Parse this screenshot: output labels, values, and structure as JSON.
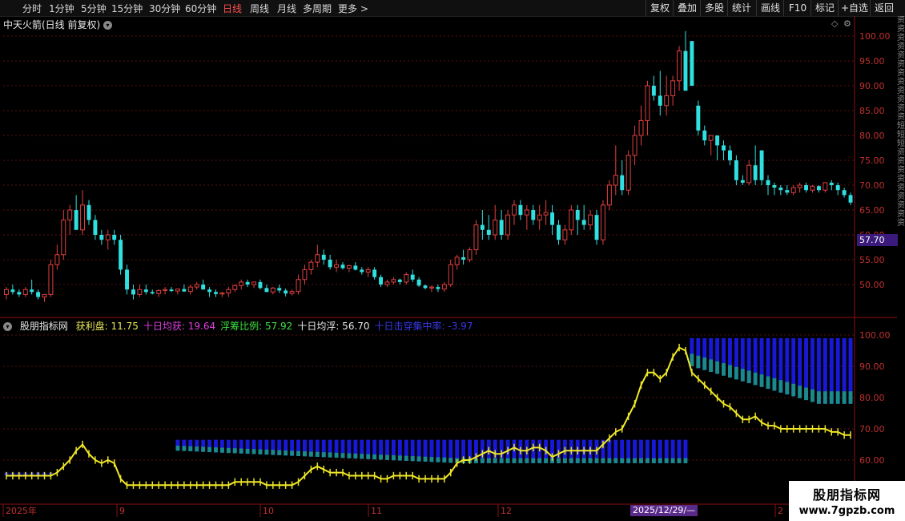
{
  "toolbar": {
    "periods": [
      "分时",
      "1分钟",
      "5分钟",
      "15分钟",
      "30分钟",
      "60分钟",
      "日线",
      "周线",
      "月线",
      "多周期",
      "更多 >"
    ],
    "active_period": "日线",
    "right_buttons": [
      "复权",
      "叠加",
      "多股",
      "统计",
      "画线",
      "F10",
      "标记",
      "+自选",
      "返回"
    ]
  },
  "main_chart": {
    "title": "中天火箭(日线 前复权)",
    "current_price_label": "57.70"
  },
  "indicator": {
    "name": "股朋指标网",
    "items": [
      {
        "label": "获利盘: 11.75",
        "color": "#e8e85a"
      },
      {
        "label": "十日均获: 19.64",
        "color": "#e040e0"
      },
      {
        "label": "浮筹比例: 57.92",
        "color": "#40e040"
      },
      {
        "label": "十日均浮: 56.70",
        "color": "#e8e8e8"
      },
      {
        "label": "十日击穿集中率: -3.97",
        "color": "#3838e8"
      }
    ]
  },
  "x_axis": {
    "labels": [
      "2025年",
      "9",
      "10",
      "11",
      "12",
      "2"
    ],
    "date_badge": "2025/12/29/—"
  },
  "watermark": {
    "title": "股朋指标网",
    "url": "www.7gpzb.com"
  },
  "side_strip": "资资资资资资资资资资资资短短短资资资资资资资资资",
  "chart_data": [
    {
      "type": "candlestick",
      "title": "中天火箭(日线 前复权)",
      "ylim": [
        44,
        101
      ],
      "y_ticks": [
        50,
        55,
        60,
        65,
        70,
        75,
        80,
        85,
        90,
        95,
        100
      ],
      "ohlc": [
        [
          48,
          49.5,
          47,
          49
        ],
        [
          49,
          50,
          48,
          48.5
        ],
        [
          48.5,
          49,
          47.5,
          48
        ],
        [
          48,
          49.5,
          47.5,
          49
        ],
        [
          49,
          51,
          48,
          48.5
        ],
        [
          48.5,
          49,
          47,
          47.5
        ],
        [
          47.5,
          48,
          46.5,
          48
        ],
        [
          48,
          55,
          47.5,
          54
        ],
        [
          54,
          58,
          53,
          56
        ],
        [
          56,
          65,
          55,
          63
        ],
        [
          63,
          66,
          60,
          65
        ],
        [
          65,
          68,
          63,
          61
        ],
        [
          61,
          69,
          60,
          66
        ],
        [
          66,
          67,
          62,
          63
        ],
        [
          63,
          64,
          59,
          60
        ],
        [
          60,
          61,
          58,
          59
        ],
        [
          59,
          61,
          57,
          60
        ],
        [
          60,
          61,
          58,
          59
        ],
        [
          59,
          60,
          52,
          53
        ],
        [
          53,
          54,
          48,
          49
        ],
        [
          49,
          50,
          47,
          48
        ],
        [
          48,
          50,
          47.5,
          49
        ],
        [
          49,
          50,
          48,
          48.5
        ],
        [
          48.5,
          49,
          48,
          48.2
        ],
        [
          48.2,
          49,
          47.5,
          48.8
        ],
        [
          48.8,
          49.5,
          48,
          49
        ],
        [
          49,
          49.5,
          48.5,
          48.7
        ],
        [
          48.7,
          49.2,
          48,
          49.1
        ],
        [
          49.1,
          50,
          48.5,
          48.6
        ],
        [
          48.6,
          50,
          48,
          49.5
        ],
        [
          49.5,
          50.5,
          49,
          50
        ],
        [
          50,
          51,
          49,
          49
        ],
        [
          49,
          49.5,
          47.5,
          48.5
        ],
        [
          48.5,
          49,
          47.5,
          48.1
        ],
        [
          48.1,
          48.5,
          47.5,
          48.3
        ],
        [
          48.3,
          49.5,
          47.5,
          49
        ],
        [
          49,
          50,
          48.5,
          49.8
        ],
        [
          49.8,
          51,
          49,
          50.5
        ],
        [
          50.5,
          51,
          49.5,
          50
        ],
        [
          50,
          50.5,
          49.3,
          50.5
        ],
        [
          50.5,
          51,
          49,
          49.3
        ],
        [
          49.3,
          50,
          48.5,
          48.5
        ],
        [
          48.5,
          49.5,
          48,
          49.3
        ],
        [
          49.3,
          50,
          48.3,
          48.8
        ],
        [
          48.8,
          49.2,
          47.6,
          48.2
        ],
        [
          48.2,
          49,
          47.8,
          48.6
        ],
        [
          48.6,
          52,
          48,
          51
        ],
        [
          51,
          54,
          50,
          53
        ],
        [
          53,
          55,
          52,
          54.5
        ],
        [
          54.5,
          58,
          53.5,
          56
        ],
        [
          56,
          57,
          54,
          55
        ],
        [
          55,
          56,
          53,
          53.5
        ],
        [
          53.5,
          55,
          52.5,
          54
        ],
        [
          54,
          54.5,
          53,
          53.3
        ],
        [
          53.3,
          54,
          52.5,
          53.8
        ],
        [
          53.8,
          54.5,
          52.8,
          53
        ],
        [
          53,
          53.5,
          52,
          52.5
        ],
        [
          52.5,
          53.5,
          51.5,
          53
        ],
        [
          53,
          53.5,
          51,
          51.5
        ],
        [
          51.5,
          52,
          49.5,
          50
        ],
        [
          50,
          51,
          49.5,
          50.5
        ],
        [
          50.5,
          51.5,
          50,
          51
        ],
        [
          51,
          51.2,
          50,
          50.5
        ],
        [
          50.5,
          52.5,
          50,
          52
        ],
        [
          52,
          53,
          50.5,
          51
        ],
        [
          51,
          51.5,
          49.5,
          49.8
        ],
        [
          49.8,
          50,
          49,
          49.3
        ],
        [
          49.3,
          49.8,
          48.5,
          49.5
        ],
        [
          49.5,
          50,
          48.5,
          49.1
        ],
        [
          49.1,
          50.5,
          48.5,
          50
        ],
        [
          50,
          55,
          49.5,
          54
        ],
        [
          54,
          56,
          53,
          55.5
        ],
        [
          55.5,
          57,
          54,
          55
        ],
        [
          55,
          57.5,
          54.5,
          57
        ],
        [
          57,
          63,
          56,
          62
        ],
        [
          62,
          65,
          59,
          61
        ],
        [
          61,
          64,
          59,
          60
        ],
        [
          60,
          66,
          59,
          63
        ],
        [
          63,
          65,
          59,
          60
        ],
        [
          60,
          65,
          59,
          64
        ],
        [
          64,
          67,
          62,
          66
        ],
        [
          66,
          67,
          63,
          64
        ],
        [
          64,
          66,
          61,
          65
        ],
        [
          65,
          66,
          62,
          63
        ],
        [
          63,
          66,
          61,
          64
        ],
        [
          64,
          67,
          62,
          64.5
        ],
        [
          64.5,
          66,
          60,
          62
        ],
        [
          62,
          63,
          58,
          59
        ],
        [
          59,
          62,
          58,
          61
        ],
        [
          61,
          66,
          60,
          65
        ],
        [
          65,
          66,
          60,
          63
        ],
        [
          63,
          66,
          61,
          62
        ],
        [
          62,
          65,
          61,
          64
        ],
        [
          64,
          65,
          58,
          59
        ],
        [
          59,
          67,
          58,
          66
        ],
        [
          66,
          71,
          65,
          70
        ],
        [
          70,
          78,
          68,
          72
        ],
        [
          72,
          75,
          68,
          69
        ],
        [
          69,
          77,
          68,
          76
        ],
        [
          76,
          82,
          74,
          80
        ],
        [
          80,
          86,
          78,
          83
        ],
        [
          83,
          91,
          80,
          90
        ],
        [
          90,
          92,
          87,
          88
        ],
        [
          88,
          93,
          84,
          86
        ],
        [
          86,
          92,
          84,
          88
        ],
        [
          88,
          92,
          86,
          91
        ],
        [
          91,
          98,
          89,
          97
        ],
        [
          97,
          101,
          93,
          89
        ],
        [
          99,
          99,
          92,
          90
        ],
        [
          86,
          87,
          80,
          81
        ],
        [
          81,
          82,
          78,
          79
        ],
        [
          79,
          80,
          76,
          80
        ],
        [
          80,
          80,
          75,
          78
        ],
        [
          78,
          79,
          75,
          77
        ],
        [
          77,
          78,
          74,
          75
        ],
        [
          75,
          76,
          70,
          71
        ],
        [
          71,
          72,
          70,
          70.5
        ],
        [
          70.5,
          75,
          70,
          74
        ],
        [
          74,
          78,
          70,
          71
        ],
        [
          77,
          77,
          70,
          71
        ],
        [
          71,
          72,
          68,
          70
        ],
        [
          70,
          70.5,
          68,
          69.5
        ],
        [
          69.5,
          70,
          68,
          69
        ],
        [
          69,
          70,
          68,
          68.5
        ],
        [
          68.5,
          70,
          68,
          69.5
        ],
        [
          69.5,
          70.5,
          68.5,
          70
        ],
        [
          70,
          70.5,
          68.5,
          69
        ],
        [
          69,
          70,
          68.5,
          69.8
        ],
        [
          69.8,
          70,
          68.5,
          69
        ],
        [
          69,
          70.5,
          68.5,
          70.5
        ],
        [
          70.5,
          71,
          69,
          70
        ],
        [
          70,
          70.5,
          68,
          69
        ],
        [
          69,
          69.5,
          67.5,
          68
        ],
        [
          68,
          68.5,
          66,
          66.5
        ]
      ]
    },
    {
      "type": "area",
      "title": "股朋指标网",
      "ylim": [
        53,
        101
      ],
      "y_ticks": [
        60,
        70,
        80,
        90,
        100
      ],
      "series": [
        {
          "name": "获利盘",
          "values": [
            55,
            55,
            55,
            55,
            55,
            55,
            55,
            55,
            56,
            58,
            60,
            63,
            65,
            62,
            60,
            59,
            60,
            59,
            54,
            52,
            52,
            52,
            52,
            52,
            52,
            52,
            52,
            52,
            52,
            52,
            52,
            52,
            52,
            52,
            52,
            52,
            53,
            53,
            53,
            53,
            53,
            52,
            52,
            52,
            52,
            52,
            53,
            55,
            57,
            58,
            57,
            56,
            56,
            56,
            55,
            55,
            55,
            55,
            55,
            54,
            54,
            55,
            55,
            55,
            55,
            54,
            54,
            54,
            54,
            54,
            56,
            59,
            60,
            60,
            61,
            62,
            63,
            62,
            62,
            63,
            64,
            63,
            63,
            64,
            64,
            63,
            61,
            62,
            63,
            63,
            63,
            63,
            63,
            63,
            65,
            67,
            69,
            70,
            74,
            78,
            84,
            88,
            88,
            86,
            88,
            93,
            96,
            95,
            88,
            86,
            84,
            82,
            80,
            78,
            77,
            75,
            73,
            73,
            74,
            72,
            71,
            71,
            70,
            70,
            70,
            70,
            70,
            70,
            70,
            70,
            69,
            69,
            68,
            68
          ]
        }
      ]
    }
  ]
}
